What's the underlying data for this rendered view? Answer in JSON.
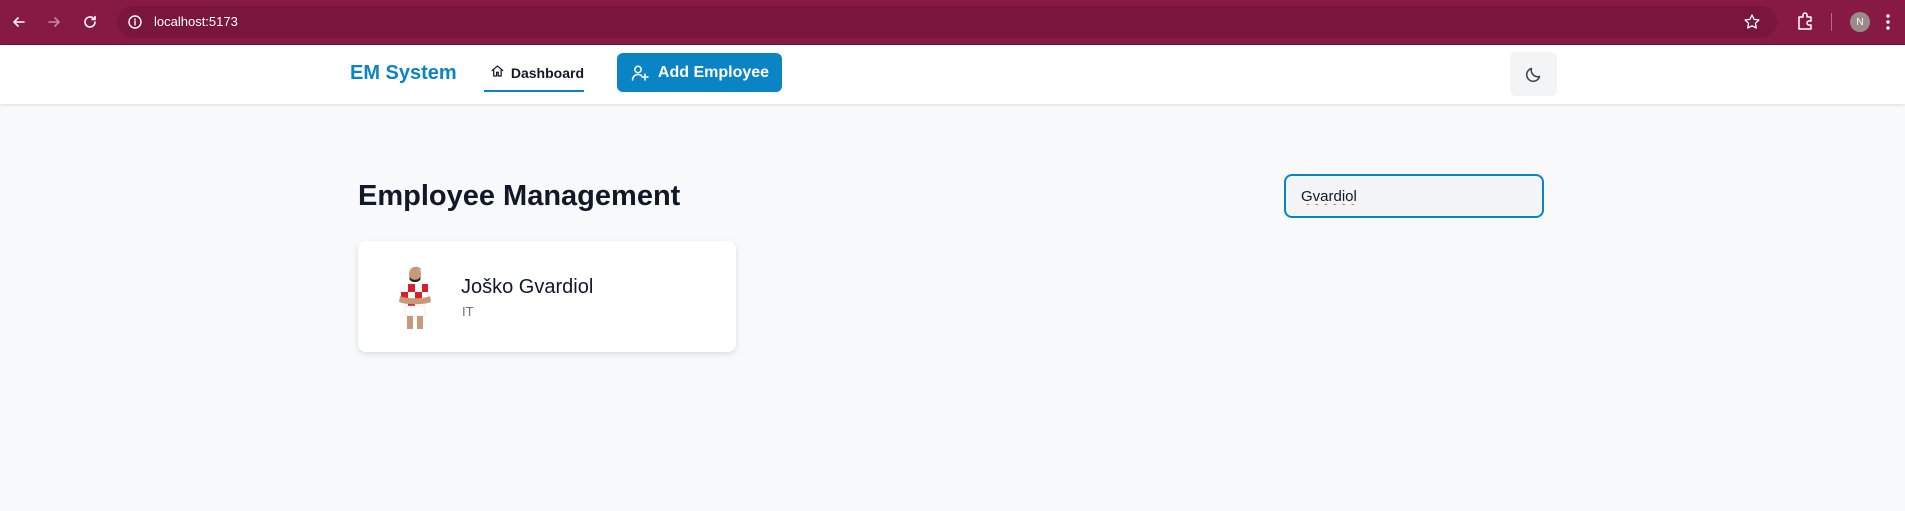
{
  "browser": {
    "url": "localhost:5173",
    "profile_initial": "N",
    "colors": {
      "chrome": "#861a45",
      "omnibox": "#7a153d"
    }
  },
  "header": {
    "brand": "EM System",
    "nav_dashboard": "Dashboard",
    "add_button": "Add Employee",
    "theme_icon": "moon-icon",
    "accent_color": "#0b84c6"
  },
  "main": {
    "title": "Employee Management",
    "search_value": "Gvardiol",
    "employees": [
      {
        "name": "Joško Gvardiol",
        "department": "IT"
      }
    ]
  }
}
